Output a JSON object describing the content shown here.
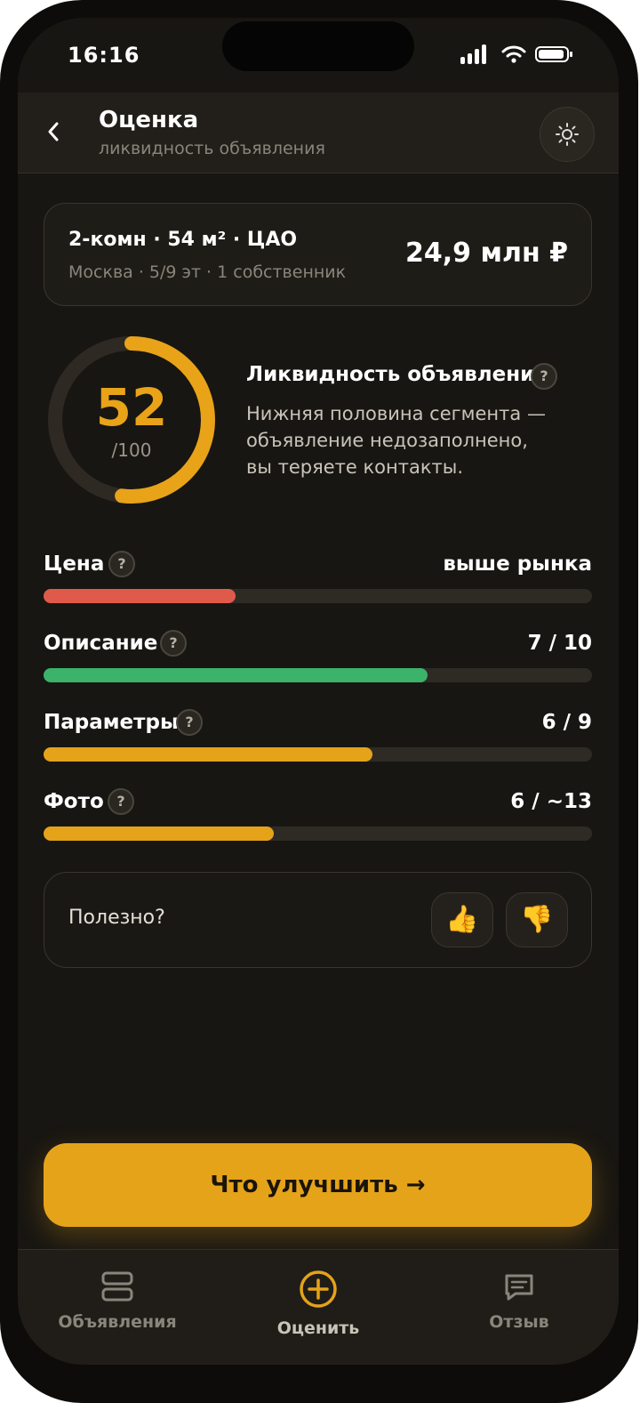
{
  "status_bar": {
    "time": "16:16"
  },
  "header": {
    "title": "Оценка",
    "subtitle": "ликвидность объявления",
    "back_icon": "chevron-left-icon",
    "theme_icon": "sun-icon"
  },
  "listing": {
    "title": "2-комн · 54 м² · ЦАО",
    "meta": "Москва · 5/9 эт · 1 собственник",
    "price": "24,9 млн ₽"
  },
  "score": {
    "value": 52,
    "value_text": "52",
    "max_text": "/100",
    "progress": 0.52,
    "color": "#e8a319",
    "track_color": "#2e2a23"
  },
  "liquidity": {
    "title": "Ликвидность объявления",
    "help": "?",
    "description_lines": [
      "Нижняя половина сегмента —",
      "объявление недозаполнено,",
      "вы теряете контакты."
    ]
  },
  "metrics": [
    {
      "label": "Цена",
      "help": "?",
      "value": "выше рынка",
      "fill": 0.35,
      "color": "#e05a4b"
    },
    {
      "label": "Описание",
      "help": "?",
      "value": "7 / 10",
      "fill": 0.7,
      "color": "#3bb36b"
    },
    {
      "label": "Параметры",
      "help": "?",
      "value": "6 / 9",
      "fill": 0.6,
      "color": "#e5a31a"
    },
    {
      "label": "Фото",
      "help": "?",
      "value": "6 / ~13",
      "fill": 0.42,
      "color": "#e5a31a"
    }
  ],
  "feedback": {
    "question": "Полезно?",
    "like": "👍",
    "dislike": "👎"
  },
  "cta": {
    "label": "Что улучшить →"
  },
  "tabbar": [
    {
      "label": "Объявления",
      "icon": "listings-icon",
      "active": false
    },
    {
      "label": "Оценить",
      "icon": "add-circle-icon",
      "active": true
    },
    {
      "label": "Отзыв",
      "icon": "feedback-icon",
      "active": false
    }
  ],
  "colors": {
    "accent": "#e5a31a",
    "background": "#181612"
  }
}
